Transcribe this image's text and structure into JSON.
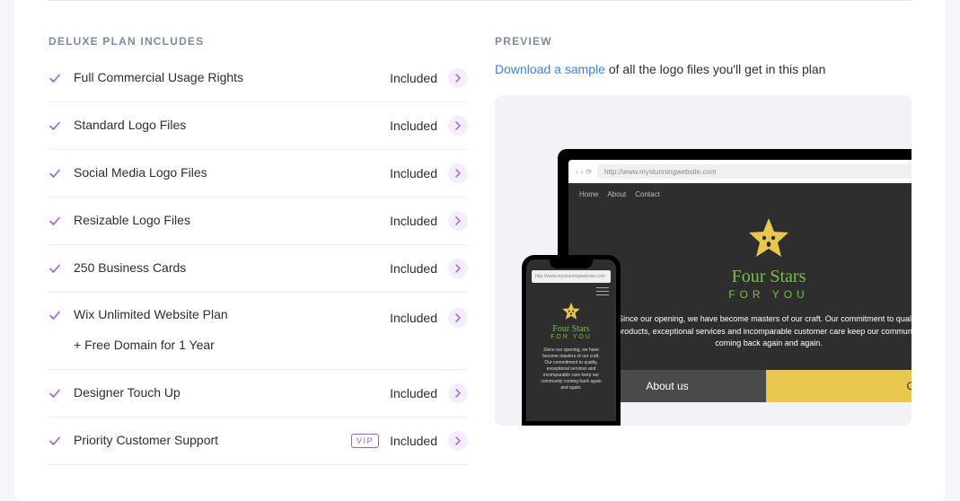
{
  "section_heading": "DELUXE PLAN INCLUDES",
  "preview_heading": "PREVIEW",
  "included_label": "Included",
  "vip_label": "VIP",
  "features": [
    {
      "text": "Full Commercial Usage Rights",
      "sub": null,
      "vip": false
    },
    {
      "text": "Standard Logo Files",
      "sub": null,
      "vip": false
    },
    {
      "text": "Social Media Logo Files",
      "sub": null,
      "vip": false
    },
    {
      "text": "Resizable Logo Files",
      "sub": null,
      "vip": false
    },
    {
      "text": "250 Business Cards",
      "sub": null,
      "vip": false
    },
    {
      "text": "Wix Unlimited Website Plan",
      "sub": "+ Free Domain for 1 Year",
      "vip": false
    },
    {
      "text": "Designer Touch Up",
      "sub": null,
      "vip": false
    },
    {
      "text": "Priority Customer Support",
      "sub": null,
      "vip": true
    }
  ],
  "preview": {
    "link_text": "Download a sample",
    "rest_text": " of all the logo files you'll get in this plan"
  },
  "mockup": {
    "url": "http://www.mystunningwebsite.com",
    "nav_items": [
      "Home",
      "About",
      "Contact"
    ],
    "brand_name": "Four Stars",
    "brand_tag": "FOR YOU",
    "desc": "Since our opening, we have become masters of our craft. Our commitment to quality products, exceptional services and incomparable customer care keep our community coming back again and again.",
    "phone_desc": "Since our opening, we have become masters of our craft. Our commitment to quality, exceptional services and incomparable care keep our community coming back again and again.",
    "tabs": {
      "about": "About us",
      "service": "Our Service"
    }
  }
}
